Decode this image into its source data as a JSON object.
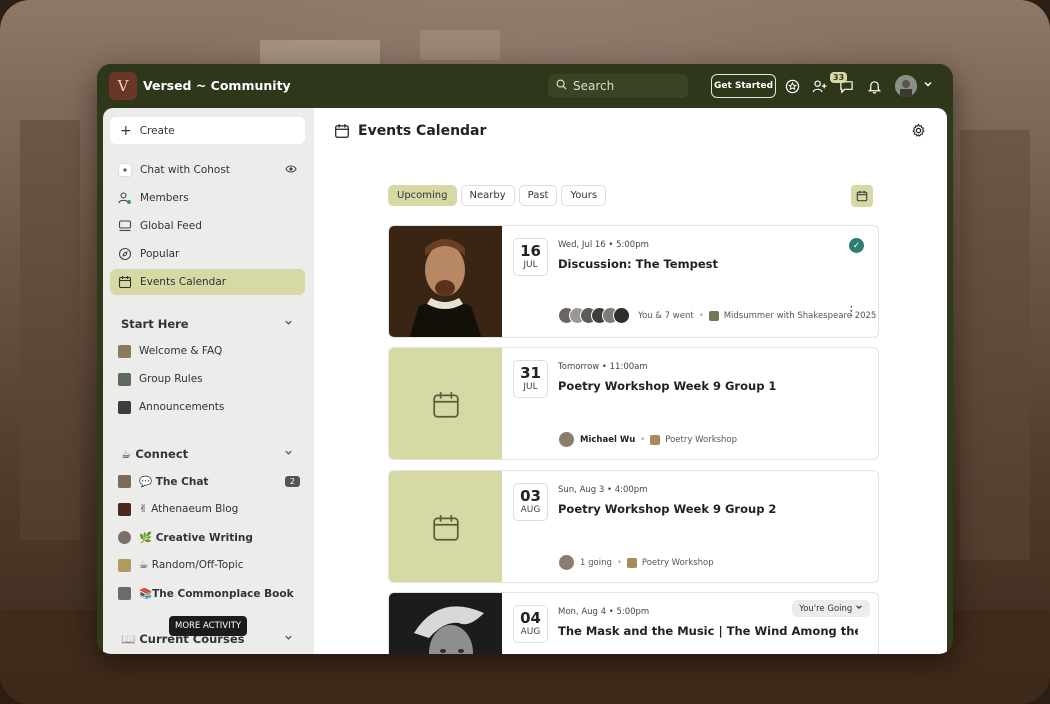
{
  "header": {
    "logo_glyph": "V",
    "title": "Versed ~ Community",
    "search_placeholder": "Search",
    "get_started": "Get Started",
    "messages_badge": "33"
  },
  "sidebar": {
    "create_label": "Create",
    "items": [
      {
        "label": "Chat with Cohost",
        "icon": "sparkle-icon"
      },
      {
        "label": "Members",
        "icon": "members-icon"
      },
      {
        "label": "Global Feed",
        "icon": "feed-icon"
      },
      {
        "label": "Popular",
        "icon": "compass-icon"
      },
      {
        "label": "Events Calendar",
        "icon": "calendar-icon",
        "active": true
      }
    ],
    "sections": [
      {
        "title": "Start Here",
        "items": [
          {
            "label": "Welcome & FAQ"
          },
          {
            "label": "Group Rules"
          },
          {
            "label": "Announcements"
          }
        ]
      },
      {
        "title": "☕ Connect",
        "items": [
          {
            "label": "💬 The Chat",
            "count": "2"
          },
          {
            "label": "✌ Athenaeum Blog"
          },
          {
            "label": "🌿 Creative Writing"
          },
          {
            "label": "☕ Random/Off-Topic"
          },
          {
            "label": "📚The Commonplace Book"
          }
        ]
      },
      {
        "title": "📖 Current Courses"
      }
    ],
    "tooltip": "MORE ACTIVITY"
  },
  "main": {
    "title": "Events Calendar",
    "filters": [
      "Upcoming",
      "Nearby",
      "Past",
      "Yours"
    ],
    "events": [
      {
        "day": "16",
        "month": "JUL",
        "when": "Wed, Jul 16 • 5:00pm",
        "title": "Discussion: The Tempest",
        "attendees": "You & 7 went",
        "group": "Midsummer with Shakespeare 2025",
        "image": "portrait"
      },
      {
        "day": "31",
        "month": "JUL",
        "when": "Tomorrow • 11:00am",
        "title": "Poetry Workshop Week 9 Group 1",
        "host": "Michael Wu",
        "group": "Poetry Workshop",
        "image": "placeholder"
      },
      {
        "day": "03",
        "month": "AUG",
        "when": "Sun, Aug 3 • 4:00pm",
        "title": "Poetry Workshop Week 9 Group 2",
        "attendees": "1 going",
        "group": "Poetry Workshop",
        "image": "placeholder"
      },
      {
        "day": "04",
        "month": "AUG",
        "when": "Mon, Aug 4 • 5:00pm",
        "title": "The Mask and the Music | The Wind Among the Reeds...",
        "rsvp": "You're Going",
        "image": "portrait-bw"
      }
    ]
  },
  "colors": {
    "topbar": "#2e3719",
    "accent": "#d6d9a4",
    "check": "#2e7d73"
  }
}
